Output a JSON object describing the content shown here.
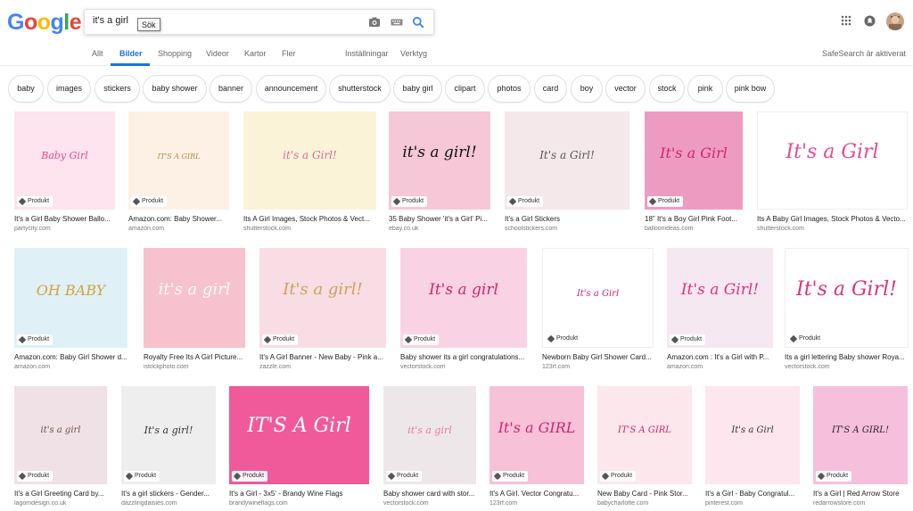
{
  "logo": "Google",
  "search": {
    "value": "it's a girl",
    "tooltip": "Sök"
  },
  "tabs": [
    "Allt",
    "Bilder",
    "Shopping",
    "Videor",
    "Kartor",
    "Fler",
    "Inställningar",
    "Verktyg"
  ],
  "active_tab": "Bilder",
  "safesearch": "SafeSearch är aktiverat",
  "chips": [
    "baby",
    "images",
    "stickers",
    "baby shower",
    "banner",
    "announcement",
    "shutterstock",
    "baby girl",
    "clipart",
    "photos",
    "card",
    "boy",
    "vector",
    "stock",
    "pink",
    "pink bow"
  ],
  "badge_label": "Produkt",
  "results": [
    {
      "title": "It's a Girl Baby Shower Ballo...",
      "source": "partycity.com",
      "art": "Baby Girl",
      "badge": true
    },
    {
      "title": "Amazon.com: Baby Shower...",
      "source": "amazon.com",
      "art": "IT'S A GIRL",
      "badge": true
    },
    {
      "title": "Its A Girl Images, Stock Photos & Vect...",
      "source": "shutterstock.com",
      "art": "it's a Girl!",
      "badge": false
    },
    {
      "title": "35 Baby Shower 'it's a Girl' Pi...",
      "source": "ebay.co.uk",
      "art": "it's a girl!",
      "badge": true
    },
    {
      "title": "It's a Girl Stickers",
      "source": "schoolstickers.com",
      "art": "It's a Girl!",
      "badge": true
    },
    {
      "title": "18\" It's a Boy Girl Pink Foot...",
      "source": "balloonideas.com",
      "art": "It's a Girl",
      "badge": true
    },
    {
      "title": "Its A Baby Girl Images, Stock Photos & Vecto...",
      "source": "shutterstock.com",
      "art": "It's a Girl",
      "badge": false
    },
    {
      "title": "Amazon.com: Baby Girl Shower d...",
      "source": "amazon.com",
      "art": "OH BABY",
      "badge": true
    },
    {
      "title": "Royalty Free Its A Girl Picture...",
      "source": "istockphoto.com",
      "art": "it's a girl",
      "badge": false
    },
    {
      "title": "It's A Girl Banner - New Baby - Pink a...",
      "source": "zazzle.com",
      "art": "It's a girl!",
      "badge": true
    },
    {
      "title": "Baby shower its a girl congratulations...",
      "source": "vectorstock.com",
      "art": "It's a girl",
      "badge": true
    },
    {
      "title": "Newborn Baby Girl Shower Card...",
      "source": "123rf.com",
      "art": "It's a Girl",
      "badge": true
    },
    {
      "title": "Amazon.com : It's a Girl with P...",
      "source": "amazon.com",
      "art": "It's a Girl!",
      "badge": true
    },
    {
      "title": "Its a girl lettering Baby shower Roya...",
      "source": "vectorstock.com",
      "art": "It's a Girl!",
      "badge": true
    },
    {
      "title": "It's a Girl Greeting Card by...",
      "source": "lagomdesign.co.uk",
      "art": "it's a girl",
      "badge": true
    },
    {
      "title": "It's a girl stickers - Gender...",
      "source": "dazzlingdaisies.com",
      "art": "It's a girl!",
      "badge": true
    },
    {
      "title": "It's a Girl - 3x5' - Brandy Wine Flags",
      "source": "brandywineflags.com",
      "art": "IT'S A Girl",
      "badge": true
    },
    {
      "title": "Baby shower card with stor...",
      "source": "vectorstock.com",
      "art": "it's a girl",
      "badge": true
    },
    {
      "title": "It's A Girl. Vector Congratu...",
      "source": "123rf.com",
      "art": "It's a GIRL",
      "badge": true
    },
    {
      "title": "New Baby Card - Pink Stor...",
      "source": "babycharlotte.com",
      "art": "IT'S A GIRL",
      "badge": true
    },
    {
      "title": "It's a Girl - Baby Congratul...",
      "source": "pinterest.com",
      "art": "It's a Girl",
      "badge": false
    },
    {
      "title": "It's a Girl | Red Arrow Store",
      "source": "redarrowstore.com",
      "art": "IT'S A GIRL!",
      "badge": true
    }
  ],
  "colors": {
    "accent": "#1a73e8",
    "pink": "#e84a8f",
    "light_pink": "#f9d3e3"
  }
}
